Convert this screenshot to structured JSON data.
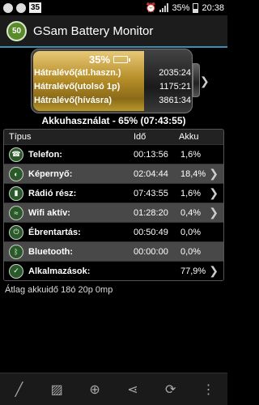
{
  "status_bar": {
    "notification_count": "35",
    "battery_percent": "35%",
    "time": "20:38"
  },
  "app": {
    "logo_text": "50",
    "title": "GSam Battery Monitor"
  },
  "battery": {
    "level_percent": "35%",
    "fill_fraction": 0.7,
    "rows": [
      {
        "label": "Hátralévő(átl.haszn.)",
        "value": "2035:24"
      },
      {
        "label": "Hátralévő(utolsó 1p)",
        "value": "1175:21"
      },
      {
        "label": "Hátralévő(hívásra)",
        "value": "3861:34"
      }
    ]
  },
  "usage_title": "Akkuhasználat - 65% (07:43:55)",
  "table": {
    "headers": {
      "type": "Típus",
      "time": "Idő",
      "battery": "Akku"
    },
    "rows": [
      {
        "icon": "phone-icon",
        "name": "Telefon:",
        "time": "00:13:56",
        "battery": "1,6%",
        "has_arrow": false
      },
      {
        "icon": "screen-icon",
        "name": "Képernyő:",
        "time": "02:04:44",
        "battery": "18,4%",
        "has_arrow": true
      },
      {
        "icon": "radio-signal-icon",
        "name": "Rádió rész:",
        "time": "07:43:55",
        "battery": "1,6%",
        "has_arrow": true
      },
      {
        "icon": "wifi-icon",
        "name": "Wifi aktív:",
        "time": "01:28:20",
        "battery": "0,4%",
        "has_arrow": true
      },
      {
        "icon": "power-icon",
        "name": "Ébrentartás:",
        "time": "00:50:49",
        "battery": "0,0%",
        "has_arrow": false
      },
      {
        "icon": "bluetooth-icon",
        "name": "Bluetooth:",
        "time": "00:00:00",
        "battery": "0,0%",
        "has_arrow": false
      },
      {
        "icon": "apps-icon",
        "name": "Alkalmazások:",
        "time": "",
        "battery": "77,9%",
        "has_arrow": true
      }
    ]
  },
  "average_text": "Átlag akkuidő 18ó 20p 0mp",
  "toolbar": {
    "buttons": [
      "chart-icon",
      "image-icon",
      "add-icon",
      "share-icon",
      "refresh-icon",
      "more-icon"
    ]
  }
}
